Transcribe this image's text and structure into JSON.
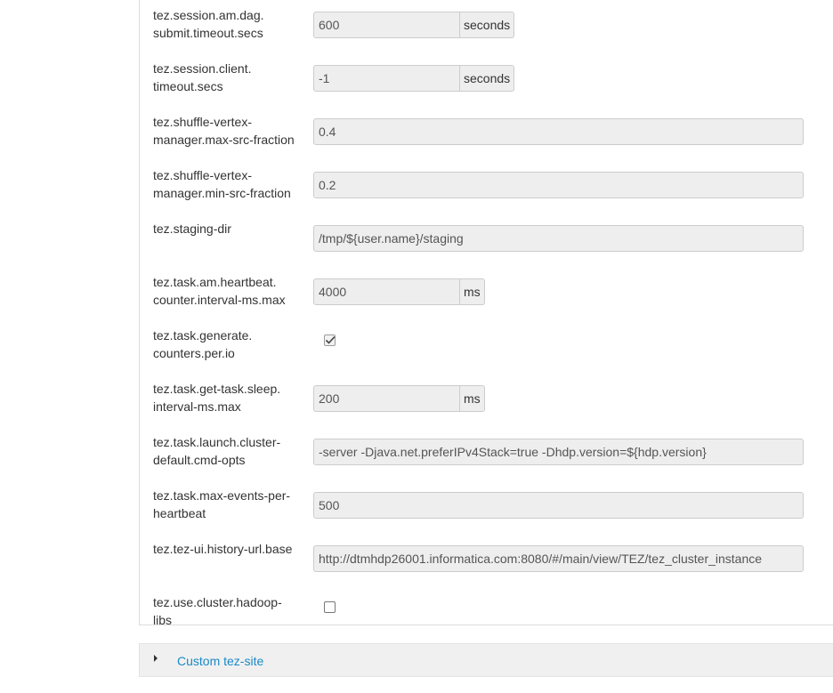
{
  "properties": [
    {
      "key": "tez-session-am-dag-submit-timeout",
      "label": "tez.session.am.dag.\nsubmit.timeout.secs",
      "type": "text-unit",
      "value": "600",
      "unit": "seconds"
    },
    {
      "key": "tez-session-client-timeout",
      "label": "tez.session.client.\ntimeout.secs",
      "type": "text-unit",
      "value": "-1",
      "unit": "seconds"
    },
    {
      "key": "tez-shuffle-max-src-fraction",
      "label": "tez.shuffle-vertex-\nmanager.max-src-fraction",
      "type": "text",
      "value": "0.4"
    },
    {
      "key": "tez-shuffle-min-src-fraction",
      "label": "tez.shuffle-vertex-\nmanager.min-src-fraction",
      "type": "text",
      "value": "0.2"
    },
    {
      "key": "tez-staging-dir",
      "label": "tez.staging-dir",
      "type": "text",
      "value": "/tmp/${user.name}/staging"
    },
    {
      "key": "tez-task-am-heartbeat",
      "label": "tez.task.am.heartbeat.\ncounter.interval-ms.max",
      "type": "text-unit",
      "value": "4000",
      "unit": "ms"
    },
    {
      "key": "tez-task-generate-counters",
      "label": "tez.task.generate.\ncounters.per.io",
      "type": "checkbox",
      "checked": true
    },
    {
      "key": "tez-task-get-task-sleep",
      "label": "tez.task.get-task.sleep.\ninterval-ms.max",
      "type": "text-unit",
      "value": "200",
      "unit": "ms"
    },
    {
      "key": "tez-task-launch-cmd-opts",
      "label": "tez.task.launch.cluster-\ndefault.cmd-opts",
      "type": "text",
      "value": "-server -Djava.net.preferIPv4Stack=true -Dhdp.version=${hdp.version}"
    },
    {
      "key": "tez-task-max-events",
      "label": "tez.task.max-events-per-\nheartbeat",
      "type": "text",
      "value": "500"
    },
    {
      "key": "tez-ui-history-url",
      "label": "tez.tez-ui.history-url.base",
      "type": "text",
      "value": "http://dtmhdp26001.informatica.com:8080/#/main/view/TEZ/tez_cluster_instance"
    },
    {
      "key": "tez-use-cluster-hadoop-libs",
      "label": "tez.use.cluster.hadoop-\nlibs",
      "type": "checkbox",
      "checked": false
    }
  ],
  "custom_section": {
    "label": "Custom tez-site",
    "icon": "caret-right-icon"
  },
  "colors": {
    "link": "#1a8ac6",
    "input_bg": "#eeeeee",
    "input_border": "#cccccc"
  }
}
